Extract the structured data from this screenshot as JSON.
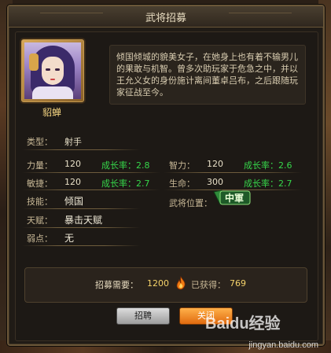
{
  "window": {
    "title": "武将招募"
  },
  "hero": {
    "name": "貂蝉",
    "description": "倾国倾城的貌美女子，在她身上也有着不输男儿的果敢与机智。曾多次助玩家于危急之中，并以王允义女的身份施计离间董卓吕布，之后跟随玩家征战至今。"
  },
  "stats": {
    "type_label": "类型：",
    "type_value": "射手",
    "strength_label": "力量：",
    "strength_value": "120",
    "strength_growth": "成长率：2.8",
    "intellect_label": "智力：",
    "intellect_value": "120",
    "intellect_growth": "成长率：2.6",
    "agility_label": "敏捷：",
    "agility_value": "120",
    "agility_growth": "成长率：2.7",
    "life_label": "生命：",
    "life_value": "300",
    "life_growth": "成长率：2.7",
    "skill_label": "技能：",
    "skill_value": "倾国",
    "position_label": "武将位置：",
    "position_value": "中軍",
    "talent_label": "天赋：",
    "talent_value": "暴击天赋",
    "weakness_label": "弱点：",
    "weakness_value": "无"
  },
  "recruit": {
    "cost_label": "招募需要：",
    "cost_value": "1200",
    "obtained_label": "已获得：",
    "obtained_value": "769"
  },
  "buttons": {
    "recruit_label": "招聘",
    "close_label": "关闭"
  },
  "watermark": {
    "brand": "Baidu经验",
    "url": "jingyan.baidu.com"
  },
  "colors": {
    "growth": "#36d64a",
    "highlight": "#f4d480",
    "close_button": "#f08a1e"
  }
}
